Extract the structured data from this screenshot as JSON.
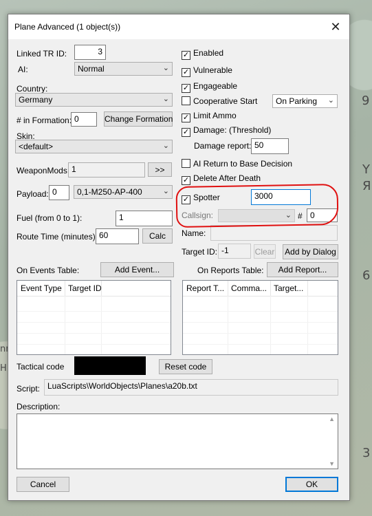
{
  "map": {
    "labels": [
      "9",
      "Y",
      "Я",
      "6",
      "3",
      "nn",
      "HI"
    ]
  },
  "window": {
    "title": "Plane Advanced (1 object(s))"
  },
  "left": {
    "linked_tr_label": "Linked TR ID:",
    "linked_tr_value": "3",
    "ai_label": "AI:",
    "ai_value": "Normal",
    "country_label": "Country:",
    "country_value": "Germany",
    "formation_label": "# in Formation:",
    "formation_value": "0",
    "change_formation": "Change Formation",
    "skin_label": "Skin:",
    "skin_value": "<default>",
    "weaponmods_label": "WeaponMods:",
    "weaponmods_value": "1",
    "weaponmods_btn": ">>",
    "payload_label": "Payload:",
    "payload_num": "0",
    "payload_value": "0,1-M250-AP-400",
    "fuel_label": "Fuel (from 0 to 1):",
    "fuel_value": "1",
    "route_label": "Route Time (minutes):",
    "route_value": "60",
    "calc_btn": "Calc"
  },
  "right": {
    "enabled": "Enabled",
    "vulnerable": "Vulnerable",
    "engageable": "Engageable",
    "coop_start": "Cooperative Start",
    "coop_start_value": "On Parking",
    "limit_ammo": "Limit Ammo",
    "damage": "Damage: (Threshold)",
    "damage_report_label": "Damage report:",
    "damage_report_value": "50",
    "ai_return": "AI Return to Base Decision",
    "delete_after": "Delete After Death",
    "spotter": "Spotter",
    "spotter_value": "3000",
    "callsign_label": "Callsign:",
    "callsign_num_label": "#",
    "callsign_num_value": "0",
    "name_label": "Name:",
    "target_label": "Target ID:",
    "target_value": "-1",
    "clear_btn": "Clear",
    "add_dialog_btn": "Add by Dialog"
  },
  "events": {
    "label": "On Events Table:",
    "add_btn": "Add Event...",
    "columns": [
      "Event Type",
      "Target ID"
    ]
  },
  "reports": {
    "label": "On Reports Table:",
    "add_btn": "Add Report...",
    "columns": [
      "Report T...",
      "Comma...",
      "Target..."
    ]
  },
  "bottom": {
    "tactical_label": "Tactical code",
    "reset_code": "Reset code",
    "script_label": "Script:",
    "script_value": "LuaScripts\\WorldObjects\\Planes\\a20b.txt",
    "description_label": "Description:",
    "cancel": "Cancel",
    "ok": "OK"
  },
  "checked": {
    "enabled": true,
    "vulnerable": true,
    "engageable": true,
    "coop_start": false,
    "limit_ammo": true,
    "damage": true,
    "ai_return": false,
    "delete_after": true,
    "spotter": true
  },
  "colors": {
    "annotation": "#e01010",
    "accent": "#0078d7"
  }
}
